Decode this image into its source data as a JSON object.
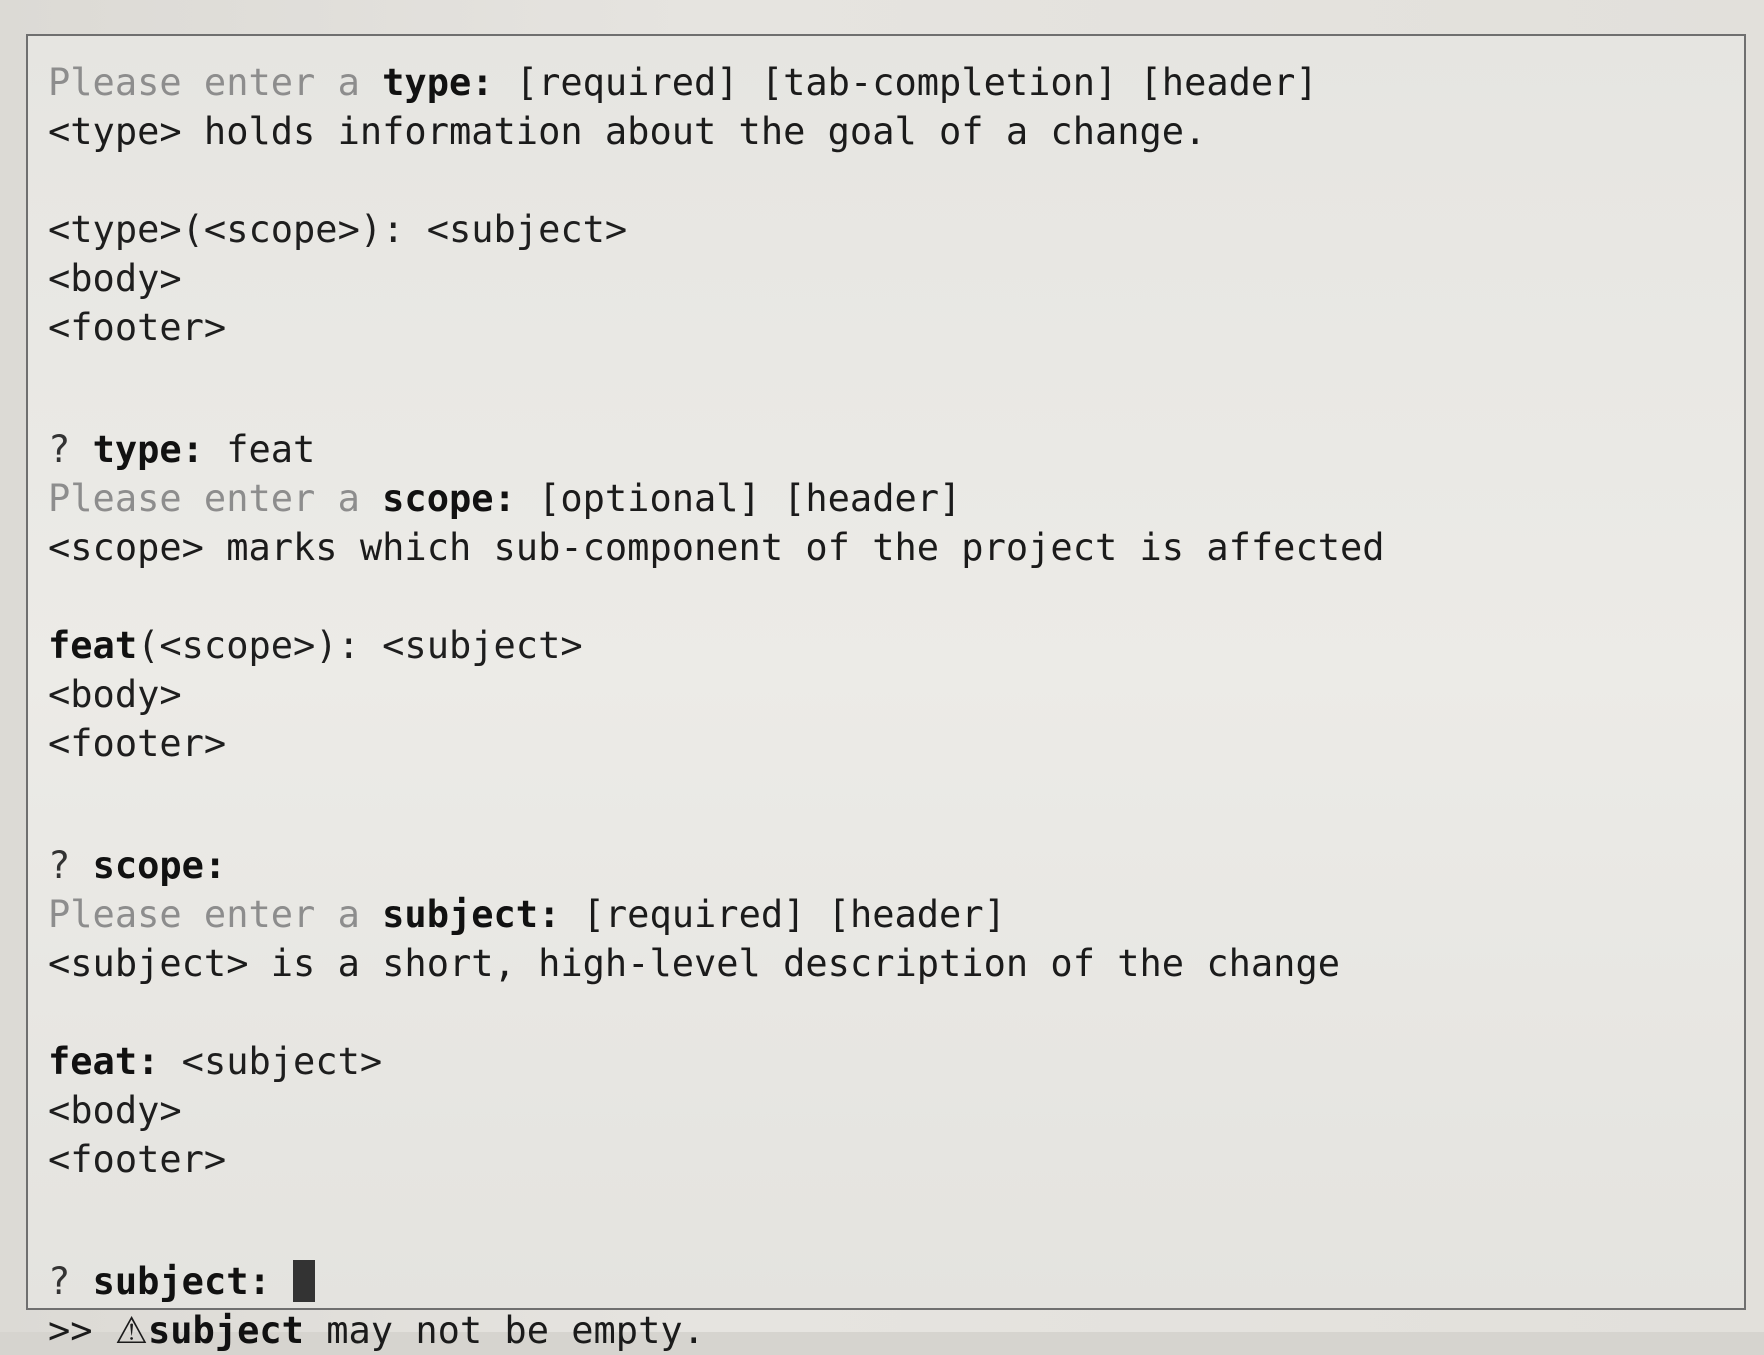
{
  "terminal": {
    "type_prompt": {
      "prefix": "Please enter a ",
      "field": "type:",
      "tags": " [required] [tab-completion] [header]",
      "help": "<type> holds information about the goal of a change.",
      "tpl_head": "<type>(<scope>): <subject>",
      "tpl_body": "<body>",
      "tpl_footer": "<footer>"
    },
    "type_answer": {
      "marker": "? ",
      "field": "type:",
      "value": " feat"
    },
    "scope_prompt": {
      "prefix": "Please enter a ",
      "field": "scope:",
      "tags": " [optional] [header]",
      "help": "<scope> marks which sub-component of the project is affected",
      "tpl_head_bold": "feat",
      "tpl_head_rest": "(<scope>): <subject>",
      "tpl_body": "<body>",
      "tpl_footer": "<footer>"
    },
    "scope_answer": {
      "marker": "? ",
      "field": "scope:",
      "value": ""
    },
    "subject_prompt": {
      "prefix": "Please enter a ",
      "field": "subject:",
      "tags": " [required] [header]",
      "help": "<subject> is a short, high-level description of the change",
      "tpl_head_bold": "feat:",
      "tpl_head_rest": " <subject>",
      "tpl_body": "<body>",
      "tpl_footer": "<footer>"
    },
    "subject_answer": {
      "marker": "? ",
      "field": "subject:"
    },
    "error": {
      "prefix": ">> ",
      "icon": "⚠",
      "field": "subject",
      "message": " may not be empty."
    }
  }
}
